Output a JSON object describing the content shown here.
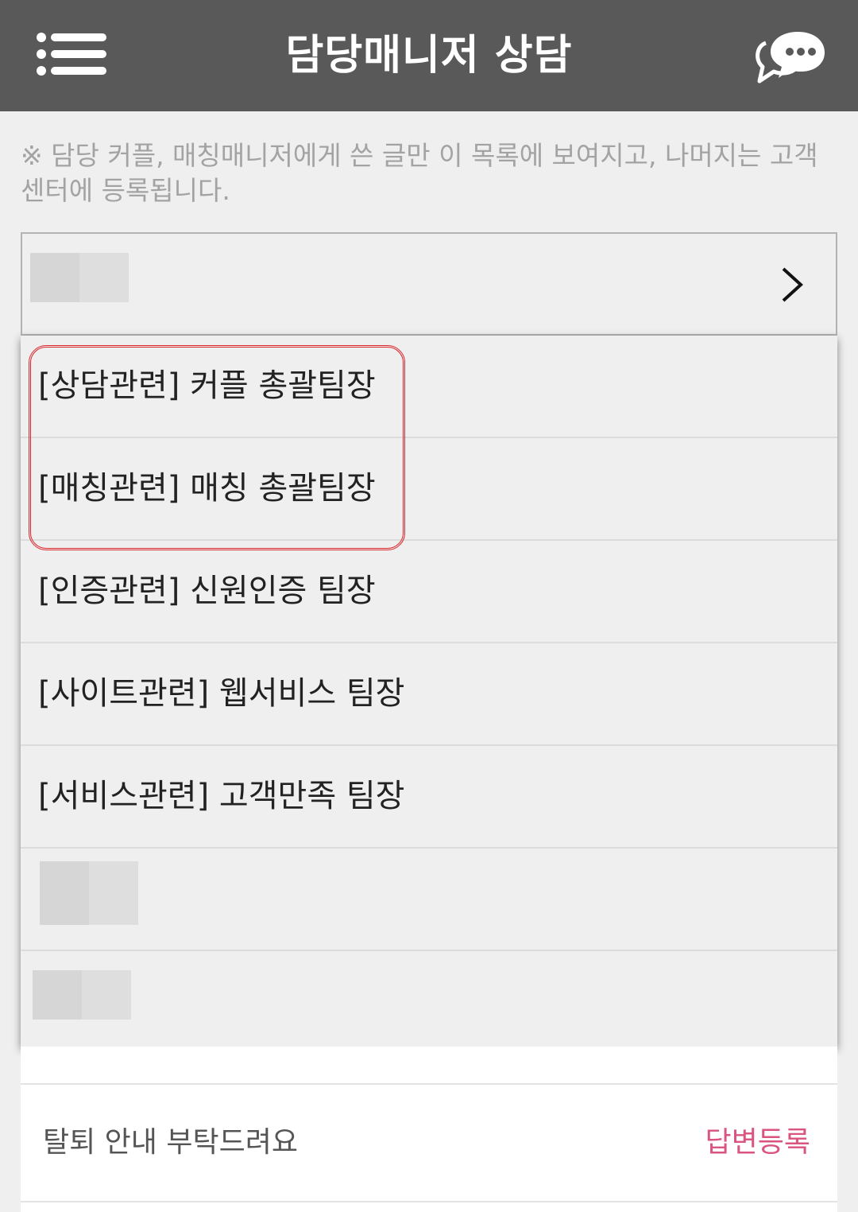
{
  "header": {
    "title": "담당매니저 상담",
    "menu_icon": "menu-icon",
    "chat_icon": "chat-bubble-icon"
  },
  "notice": "※ 담당 커플, 매칭매니저에게 쓴 글만 이 목록에 보여지고, 나머지는 고객센터에 등록됩니다.",
  "selector": {
    "icon": "chevron-right-icon"
  },
  "dropdown": {
    "options": [
      {
        "label": "[상담관련] 커플 총괄팀장"
      },
      {
        "label": "[매칭관련] 매칭 총괄팀장"
      },
      {
        "label": "[인증관련] 신원인증 팀장"
      },
      {
        "label": "[사이트관련] 웹서비스 팀장"
      },
      {
        "label": "[서비스관련] 고객만족 팀장"
      }
    ],
    "highlight_color": "#d9262b"
  },
  "list": {
    "items": [
      {
        "title": "탈퇴 안내 부탁드려요",
        "status": "답변등록"
      }
    ]
  },
  "colors": {
    "header_bg": "#595959",
    "status_pink": "#d9557f"
  }
}
